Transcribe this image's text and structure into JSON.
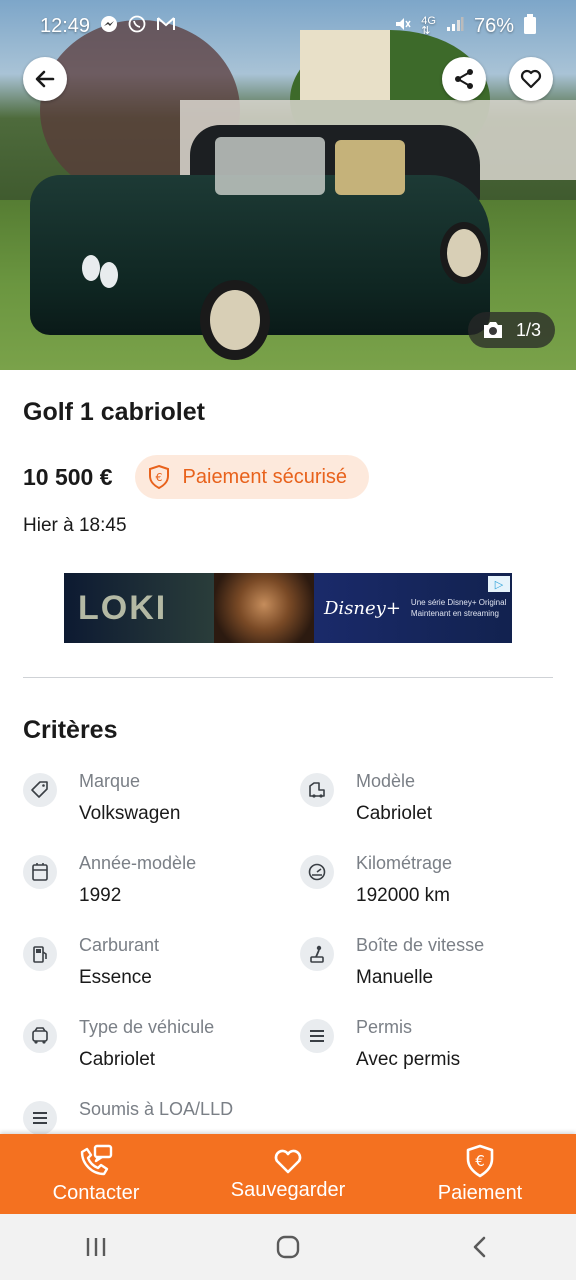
{
  "status_bar": {
    "time": "12:49",
    "battery": "76%",
    "icons_left": [
      "messenger-icon",
      "whatsapp-icon",
      "gmail-icon"
    ],
    "icons_right": [
      "mute-icon",
      "4g-icon",
      "signal-icon",
      "battery-icon"
    ]
  },
  "photo": {
    "counter": "1/3"
  },
  "listing": {
    "title": "Golf 1 cabriolet",
    "price": "10 500 €",
    "secure_payment_label": "Paiement sécurisé",
    "date": "Hier à 18:45"
  },
  "ad": {
    "brand_text": "LOKI",
    "disney_logo": "Disney+",
    "disney_line1": "Une série Disney+ Original",
    "disney_line2": "Maintenant en streaming",
    "ad_choices": "▷"
  },
  "criteria": {
    "title": "Critères",
    "items": [
      {
        "label": "Marque",
        "value": "Volkswagen",
        "icon": "tag-icon"
      },
      {
        "label": "Modèle",
        "value": "Cabriolet",
        "icon": "car-model-icon"
      },
      {
        "label": "Année-modèle",
        "value": "1992",
        "icon": "calendar-icon"
      },
      {
        "label": "Kilométrage",
        "value": "192000 km",
        "icon": "odometer-icon"
      },
      {
        "label": "Carburant",
        "value": "Essence",
        "icon": "fuel-pump-icon"
      },
      {
        "label": "Boîte de vitesse",
        "value": "Manuelle",
        "icon": "gearshift-icon"
      },
      {
        "label": "Type de véhicule",
        "value": "Cabriolet",
        "icon": "vehicle-type-icon"
      },
      {
        "label": "Permis",
        "value": "Avec permis",
        "icon": "list-icon"
      },
      {
        "label": "Soumis à LOA/LLD",
        "value": "",
        "icon": "list-icon"
      }
    ]
  },
  "actions": {
    "contact": "Contacter",
    "save": "Sauvegarder",
    "payment": "Paiement"
  },
  "colors": {
    "accent": "#f47120",
    "badge_bg": "#fde9dc",
    "badge_text": "#e8621c"
  }
}
